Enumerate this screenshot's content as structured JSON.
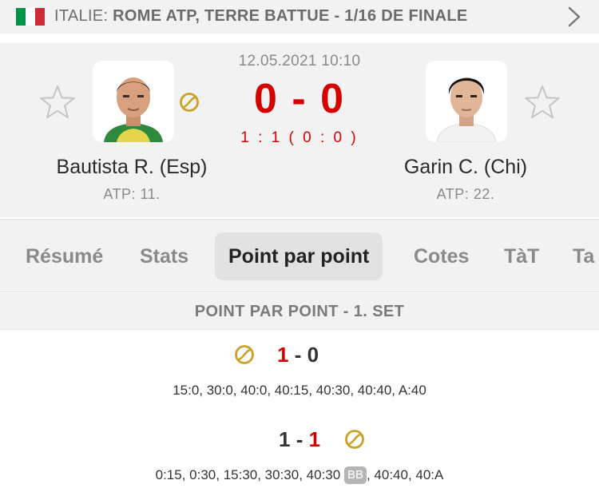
{
  "header": {
    "country": "ITALIE:",
    "tournament": "ROME ATP, TERRE BATTUE - 1/16 DE FINALE",
    "flag_colors": [
      "#009246",
      "#ffffff",
      "#ce2b37"
    ],
    "chevron_icon": "chevron-right-icon"
  },
  "match": {
    "datetime": "12.05.2021 10:10",
    "score": "0 - 0",
    "set_score": "1 : 1 ( 0 : 0 )",
    "serving_player": "home",
    "home": {
      "name": "Bautista R. (Esp)",
      "rank": "ATP: 11.",
      "favorite_icon": "star-outline-icon"
    },
    "away": {
      "name": "Garin C. (Chi)",
      "rank": "ATP: 22.",
      "favorite_icon": "star-outline-icon"
    }
  },
  "tabs": [
    {
      "label": "Résumé",
      "active": false
    },
    {
      "label": "Stats",
      "active": false
    },
    {
      "label": "Point par point",
      "active": true
    },
    {
      "label": "Cotes",
      "active": false
    },
    {
      "label": "TàT",
      "active": false
    },
    {
      "label": "Ta",
      "active": false
    }
  ],
  "section": {
    "title": "POINT PAR POINT - 1. SET"
  },
  "games": [
    {
      "home": "1",
      "away": "0",
      "separator": "-",
      "winner": "home",
      "server": "home",
      "points": "15:0, 30:0, 40:0, 40:15, 40:30, 40:40, A:40"
    },
    {
      "home": "1",
      "away": "1",
      "separator": "-",
      "winner": "away",
      "server": "away",
      "points_before": "0:15, 0:30, 15:30, 30:30, 40:30",
      "badge": "BB",
      "points_after": ", 40:40, 40:A"
    }
  ],
  "colors": {
    "accent_red": "#d40000",
    "serve_gold": "#c9a227",
    "panel_bg": "#f2f2f2"
  }
}
